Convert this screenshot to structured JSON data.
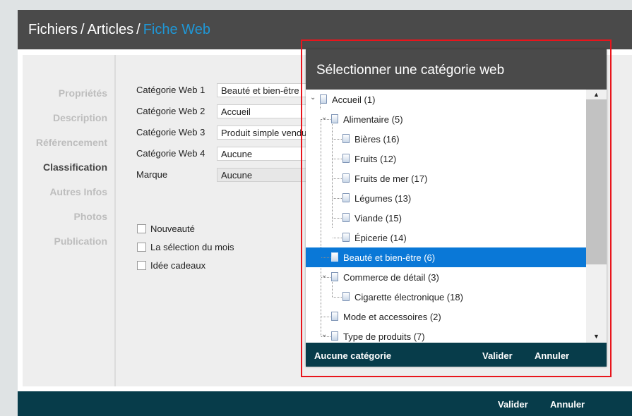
{
  "header": {
    "crumb1": "Fichiers",
    "sep": "/",
    "crumb2": "Articles",
    "current": "Fiche Web"
  },
  "nav": {
    "items": [
      {
        "label": "Propriétés"
      },
      {
        "label": "Description"
      },
      {
        "label": "Référencement"
      },
      {
        "label": "Classification"
      },
      {
        "label": "Autres Infos"
      },
      {
        "label": "Photos"
      },
      {
        "label": "Publication"
      }
    ],
    "active": "Classification"
  },
  "form": {
    "labels": [
      "Catégorie Web 1",
      "Catégorie Web 2",
      "Catégorie Web 3",
      "Catégorie Web 4",
      "Marque"
    ],
    "values": [
      "Beauté et bien-être",
      "Accueil",
      "Produit simple vendu",
      "Aucune",
      "Aucune"
    ],
    "checkboxes": [
      {
        "label": "Nouveauté",
        "checked": false
      },
      {
        "label": "La sélection du mois",
        "checked": false
      },
      {
        "label": "Idée cadeaux",
        "checked": false
      }
    ]
  },
  "footer": {
    "validate": "Valider",
    "cancel": "Annuler"
  },
  "dialog": {
    "title": "Sélectionner une catégorie web",
    "tree": [
      {
        "label": "Accueil (1)",
        "level": 0,
        "expandable": true
      },
      {
        "label": "Alimentaire (5)",
        "level": 1,
        "expandable": true
      },
      {
        "label": "Bières (16)",
        "level": 2,
        "expandable": false
      },
      {
        "label": "Fruits (12)",
        "level": 2,
        "expandable": false
      },
      {
        "label": "Fruits de mer (17)",
        "level": 2,
        "expandable": false
      },
      {
        "label": "Légumes (13)",
        "level": 2,
        "expandable": false
      },
      {
        "label": "Viande (15)",
        "level": 2,
        "expandable": false
      },
      {
        "label": "Épicerie (14)",
        "level": 2,
        "expandable": false
      },
      {
        "label": "Beauté et bien-être (6)",
        "level": 1,
        "expandable": false,
        "selected": true
      },
      {
        "label": "Commerce de détail (3)",
        "level": 1,
        "expandable": true
      },
      {
        "label": "Cigarette électronique (18)",
        "level": 2,
        "expandable": false
      },
      {
        "label": "Mode et accessoires (2)",
        "level": 1,
        "expandable": false
      },
      {
        "label": "Type de produits (7)",
        "level": 1,
        "expandable": true
      }
    ],
    "footer": {
      "none": "Aucune catégorie",
      "validate": "Valider",
      "cancel": "Annuler"
    },
    "scrollbar": {
      "up": "▲",
      "down": "▼"
    }
  },
  "colors": {
    "header_bg": "#4a4a4a",
    "footer_bg": "#073c4a",
    "accent": "#1f97d6",
    "selection": "#0a78d7",
    "highlight_border": "#e8151c"
  }
}
